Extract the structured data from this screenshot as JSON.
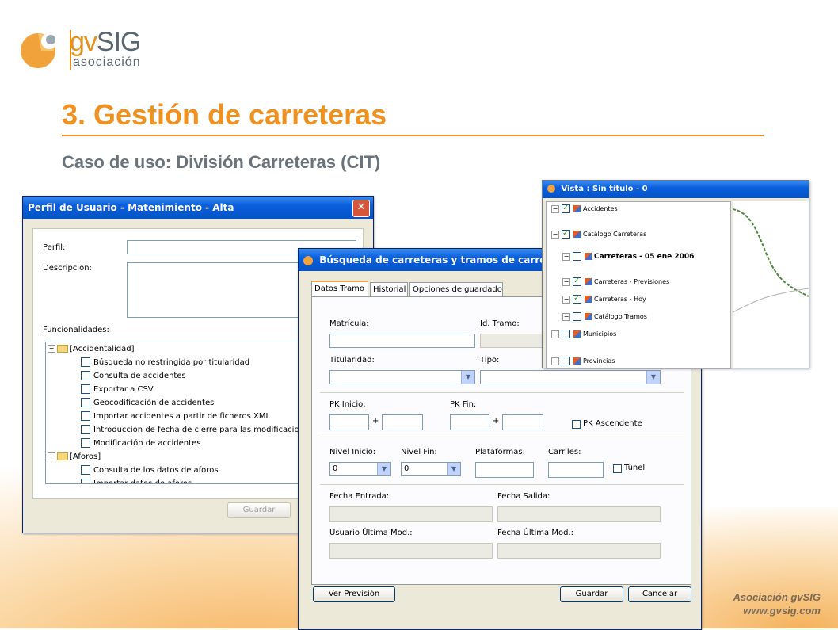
{
  "slide": {
    "logo_brand_a": "gv",
    "logo_brand_b": "SIG",
    "logo_sub": "asociación",
    "title": "3. Gestión de carreteras",
    "subtitle": "Caso de uso: División Carreteras (CIT)",
    "footer_line1": "Asociación gvSIG",
    "footer_line2": "www.gvsig.com",
    "accent_color": "#f0901e"
  },
  "profile_window": {
    "title": "Perfil de Usuario - Matenimiento - Alta",
    "perfil_label": "Perfil:",
    "descripcion_label": "Descripcion:",
    "funcionalidades_label": "Funcionalidades:",
    "tree": [
      {
        "level": 0,
        "type": "folder",
        "label": "[Accidentalidad]"
      },
      {
        "level": 1,
        "type": "check",
        "label": "Búsqueda no restringida por titularidad"
      },
      {
        "level": 1,
        "type": "check",
        "label": "Consulta de accidentes"
      },
      {
        "level": 1,
        "type": "check",
        "label": "Exportar a CSV"
      },
      {
        "level": 1,
        "type": "check",
        "label": "Geocodificación de accidentes"
      },
      {
        "level": 1,
        "type": "check",
        "label": "Importar accidentes a partir de ficheros XML"
      },
      {
        "level": 1,
        "type": "check",
        "label": "Introducción de fecha de cierre para las modificacio"
      },
      {
        "level": 1,
        "type": "check",
        "label": "Modificación de accidentes"
      },
      {
        "level": 0,
        "type": "folder",
        "label": "[Aforos]"
      },
      {
        "level": 1,
        "type": "check",
        "label": "Consulta de los datos de aforos"
      },
      {
        "level": 1,
        "type": "check",
        "label": "Importar datos de aforos"
      }
    ],
    "guardar_label": "Guardar"
  },
  "search_window": {
    "title": "Búsqueda de carreteras y tramos de carretera",
    "tabs": [
      "Datos Tramo",
      "Historial",
      "Opciones de guardado"
    ],
    "matricula_label": "Matrícula:",
    "id_tramo_label": "Id. Tramo:",
    "titularidad_label": "Titularidad:",
    "tipo_label": "Tipo:",
    "pk_inicio_label": "PK Inicio:",
    "pk_fin_label": "PK Fin:",
    "plus": "+",
    "pk_ascendente_label": "PK Ascendente",
    "nivel_inicio_label": "Nivel Inicio:",
    "nivel_fin_label": "Nivel Fin:",
    "plataformas_label": "Plataformas:",
    "carriles_label": "Carriles:",
    "tunel_label": "Túnel",
    "nivel_inicio_value": "0",
    "nivel_fin_value": "0",
    "fecha_entrada_label": "Fecha Entrada:",
    "fecha_salida_label": "Fecha Salida:",
    "usuario_label": "Usuario Última Mod.:",
    "fecha_ultima_label": "Fecha Última Mod.:",
    "ver_prevision_label": "Ver Previsión",
    "guardar_label": "Guardar",
    "cancelar_label": "Cancelar"
  },
  "view_window": {
    "title": "Vista : Sin título - 0",
    "layers": [
      {
        "indent": 0,
        "checked": true,
        "label": "Accidentes",
        "bold": false
      },
      {
        "indent": 0,
        "checked": true,
        "label": "Catálogo Carreteras",
        "bold": false
      },
      {
        "indent": 1,
        "checked": false,
        "label": "Carreteras - 05 ene 2006",
        "bold": true
      },
      {
        "indent": 1,
        "checked": true,
        "label": "Carreteras - Previsiones",
        "bold": false
      },
      {
        "indent": 1,
        "checked": true,
        "label": "Carreteras - Hoy",
        "bold": false
      },
      {
        "indent": 1,
        "checked": false,
        "label": "Catálogo Tramos",
        "bold": false
      },
      {
        "indent": 0,
        "checked": false,
        "label": "Municipios",
        "bold": false
      },
      {
        "indent": 0,
        "checked": false,
        "label": "Provincias",
        "bold": false
      }
    ]
  }
}
